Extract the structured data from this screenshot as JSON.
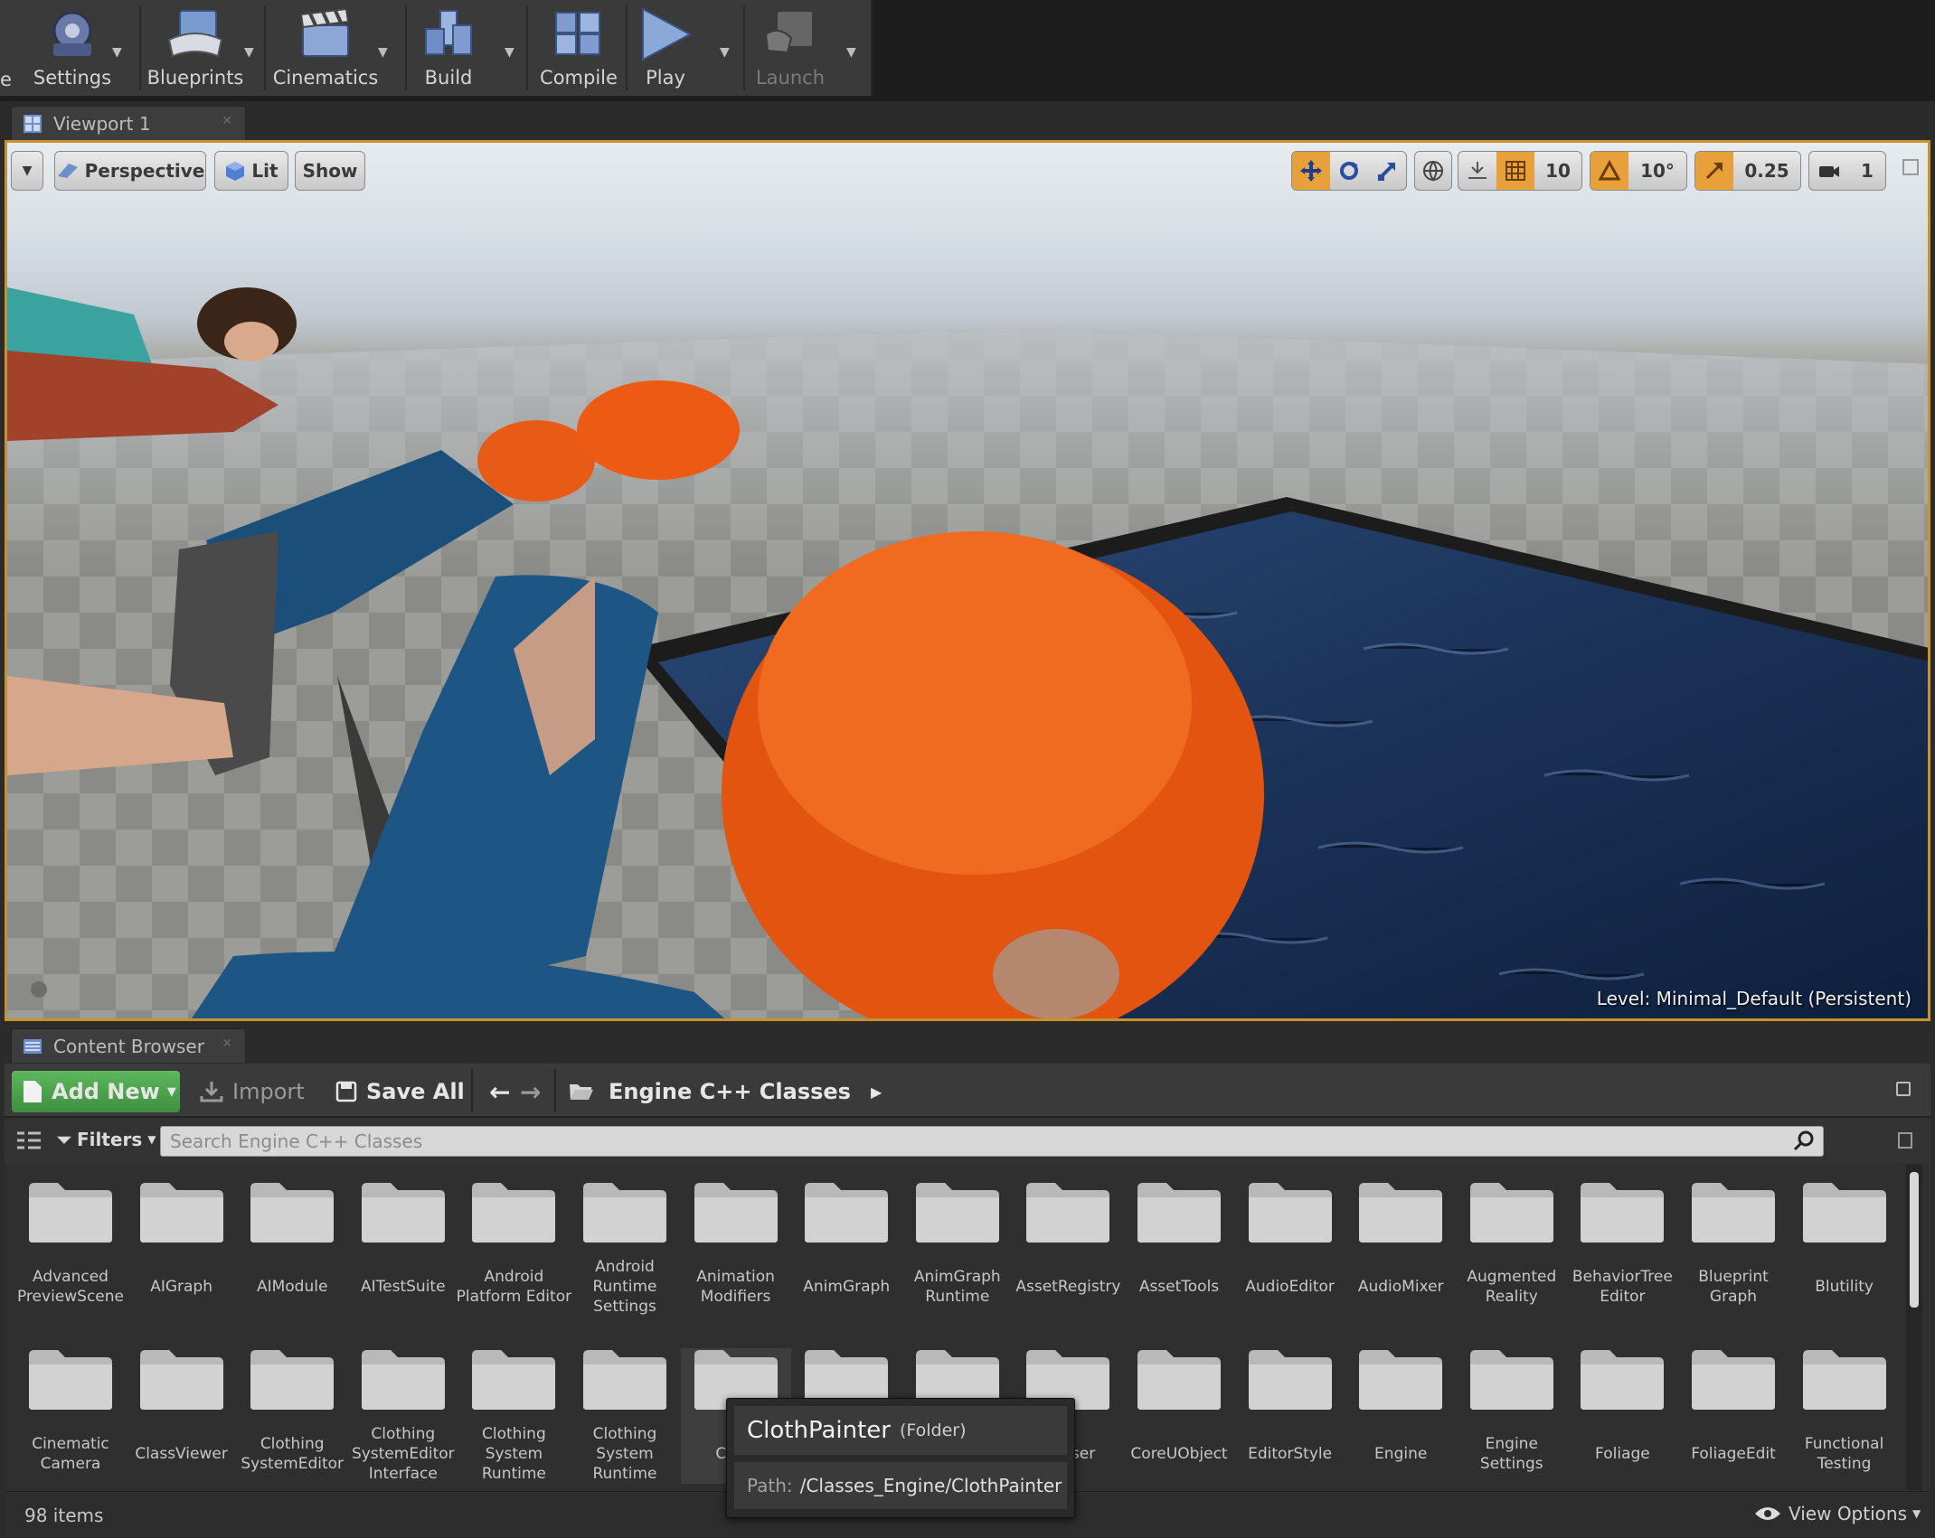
{
  "toolbar": {
    "cut_label": "e",
    "buttons": [
      {
        "label": "Settings"
      },
      {
        "label": "Blueprints"
      },
      {
        "label": "Cinematics"
      },
      {
        "label": "Build"
      },
      {
        "label": "Compile"
      },
      {
        "label": "Play"
      },
      {
        "label": "Launch",
        "disabled": true
      }
    ]
  },
  "viewport": {
    "tab_label": "Viewport 1",
    "perspective_label": "Perspective",
    "lit_label": "Lit",
    "show_label": "Show",
    "grid_snap": "10",
    "rotation_snap": "10°",
    "scale_snap": "0.25",
    "camera_speed": "1",
    "level_label": "Level:  Minimal_Default (Persistent)"
  },
  "content_browser": {
    "tab_label": "Content Browser",
    "add_new_label": "Add New",
    "import_label": "Import",
    "save_all_label": "Save All",
    "path_label": "Engine C++ Classes",
    "filters_label": "Filters",
    "search_placeholder": "Search Engine C++ Classes",
    "items_count": "98 items",
    "view_options_label": "View Options",
    "folders_row1": [
      "Advanced PreviewScene",
      "AIGraph",
      "AIModule",
      "AITestSuite",
      "Android Platform Editor",
      "Android Runtime Settings",
      "Animation Modifiers",
      "AnimGraph",
      "AnimGraph Runtime",
      "AssetRegistry",
      "AssetTools",
      "AudioEditor",
      "AudioMixer",
      "Augmented Reality",
      "BehaviorTree Editor",
      "Blueprint Graph",
      "Blutility"
    ],
    "folders_row2": [
      "Cinematic Camera",
      "ClassViewer",
      "Clothing SystemEditor",
      "Clothing SystemEditor Interface",
      "Clothing System Runtime",
      "Clothing System Runtime",
      "Cloth",
      "",
      "",
      "ent ser",
      "CoreUObject",
      "EditorStyle",
      "Engine",
      "Engine Settings",
      "Foliage",
      "FoliageEdit",
      "Functional Testing"
    ],
    "tooltip": {
      "name": "ClothPainter",
      "type": "(Folder)",
      "path_label": "Path:",
      "path": "/Classes_Engine/ClothPainter"
    }
  },
  "colors": {
    "accent_orange": "#e8a13a",
    "viewport_border": "#c9932a",
    "add_new_green": "#4ea64e",
    "water": "#1d3456"
  }
}
